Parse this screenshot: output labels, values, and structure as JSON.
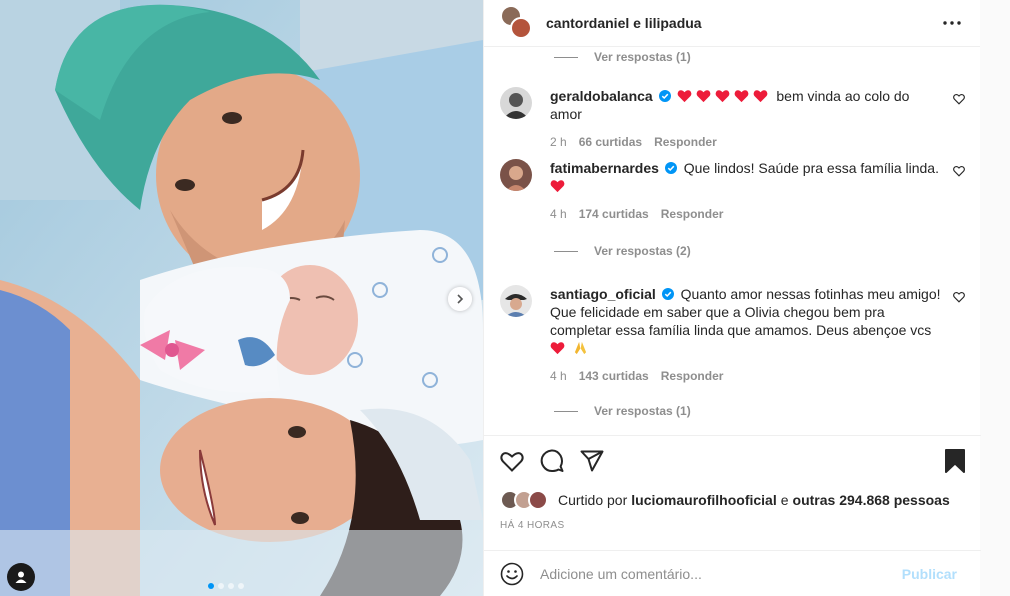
{
  "post": {
    "author": "cantordaniel e lilipadua",
    "time_ago": "HÁ 4 HORAS",
    "carousel": {
      "slides": 4,
      "active_index": 0
    }
  },
  "comments": {
    "top_replies": "Ver respostas (1)",
    "items": [
      {
        "username": "geraldobalanca",
        "verified": true,
        "hearts": 5,
        "text": "bem vinda ao colo do amor",
        "time": "2 h",
        "likes": "66 curtidas",
        "reply": "Responder",
        "replies": ""
      },
      {
        "username": "fatimabernardes",
        "verified": true,
        "text": "Que lindos! Saúde pra essa família linda.",
        "trailing_hearts": 1,
        "time": "4 h",
        "likes": "174 curtidas",
        "reply": "Responder",
        "replies": "Ver respostas (2)"
      },
      {
        "username": "santiago_oficial",
        "verified": true,
        "text": "Quanto amor nessas fotinhas meu amigo! Que felicidade em saber que a Olivia chegou bem pra completar essa família linda que amamos. Deus abençoe vcs",
        "trailing_emoji": "heart, folded-hands",
        "time": "4 h",
        "likes": "143 curtidas",
        "reply": "Responder",
        "replies": "Ver respostas (1)"
      }
    ]
  },
  "likes": {
    "prefix": "Curtido por",
    "first_user": "luciomaurofilhooficial",
    "connector": "e",
    "others": "outras 294.868 pessoas"
  },
  "add_comment": {
    "placeholder": "Adicione um comentário...",
    "publish": "Publicar"
  },
  "colors": {
    "heart_red": "#ed1c3a",
    "verified_blue": "#0095f6",
    "publish_disabled": "#b2dffc",
    "muted_text": "#8e8e8e"
  },
  "icons": [
    "more-icon",
    "like-icon",
    "comment-icon",
    "share-icon",
    "bookmark-icon",
    "emoji-icon",
    "next-arrow-icon",
    "user-tag-icon",
    "verified-icon"
  ]
}
